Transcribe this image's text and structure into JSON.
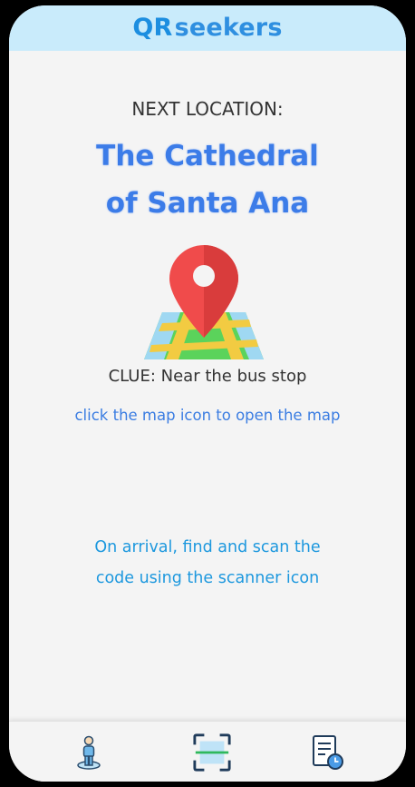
{
  "header": {
    "logo_qr": "QR",
    "logo_seekers": "seekers"
  },
  "main": {
    "next_label": "NEXT LOCATION:",
    "location_line1": "The Cathedral",
    "location_line2": "of Santa Ana",
    "clue": "CLUE: Near the bus stop",
    "map_hint": "click the map icon to open the map",
    "scan_hint_line1": "On arrival, find and scan the",
    "scan_hint_line2": "code using the scanner icon"
  },
  "icons": {
    "map": "map-pin-icon",
    "profile": "person-location-icon",
    "scanner": "qr-scanner-icon",
    "history": "report-clock-icon"
  },
  "colors": {
    "header_bg": "#c9ebfb",
    "brand_blue": "#2f8fe0",
    "title_blue": "#3c7ce8",
    "scan_hint_blue": "#1d98de",
    "pin_red": "#f04b4b"
  }
}
